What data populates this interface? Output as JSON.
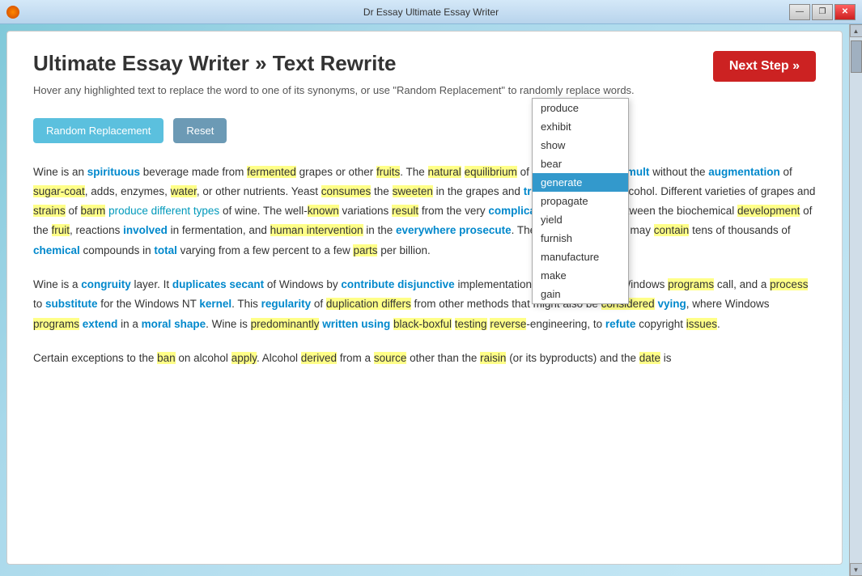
{
  "window": {
    "title": "Dr Essay Ultimate Essay Writer",
    "icon": "orange-circle"
  },
  "titlebar": {
    "minimize": "—",
    "restore": "❐",
    "close": "✕"
  },
  "header": {
    "title": "Ultimate Essay Writer » Text Rewrite",
    "subtitle": "Hover any highlighted text to replace the word to one of its synonyms, or use \"Random Replacement\" to randomly replace words."
  },
  "buttons": {
    "random_replacement": "Random Replacement",
    "reset": "Reset",
    "next_step": "Next Step »"
  },
  "dropdown": {
    "items": [
      "produce",
      "exhibit",
      "show",
      "bear",
      "generate",
      "propagate",
      "yield",
      "furnish",
      "manufacture",
      "make",
      "gain"
    ],
    "selected": "generate"
  },
  "essay": {
    "paragraph1": "Wine is an spirituous beverage made from fermented grapes or other fruits. The natural equilibrium of grapes lets them tumult without the augmentation of sugar-coat, adds, enzymes, water, or other nutrients. Yeast consumes the sweeten in the grapes and translate them into alcohol. Different varieties of grapes and strains of barm produce different types of wine. The well-known variations result from the very complicated interactions between the biochemical development of the fruit, reactions involved in fermentation, and human intervention in the everywhere prosecute. The final consequence may contain tens of thousands of chemical compounds in total varying from a few percent to a few parts per billion.",
    "paragraph2": "Wine is a congruity layer. It duplicates secant of Windows by contribute disjunctive implementations of the DLLs that Windows programs call, and a process to substitute for the Windows NT kernel. This regularity of duplication differs from other methods that might also be considered vying, where Windows programs extend in a moral shape. Wine is predominantly written using black-boxful testing reverse-engineering, to refute copyright issues.",
    "paragraph3": "Certain exceptions to the ban on alcohol apply. Alcohol derived from a source other than the raisin (or its byproducts) and the date is"
  }
}
